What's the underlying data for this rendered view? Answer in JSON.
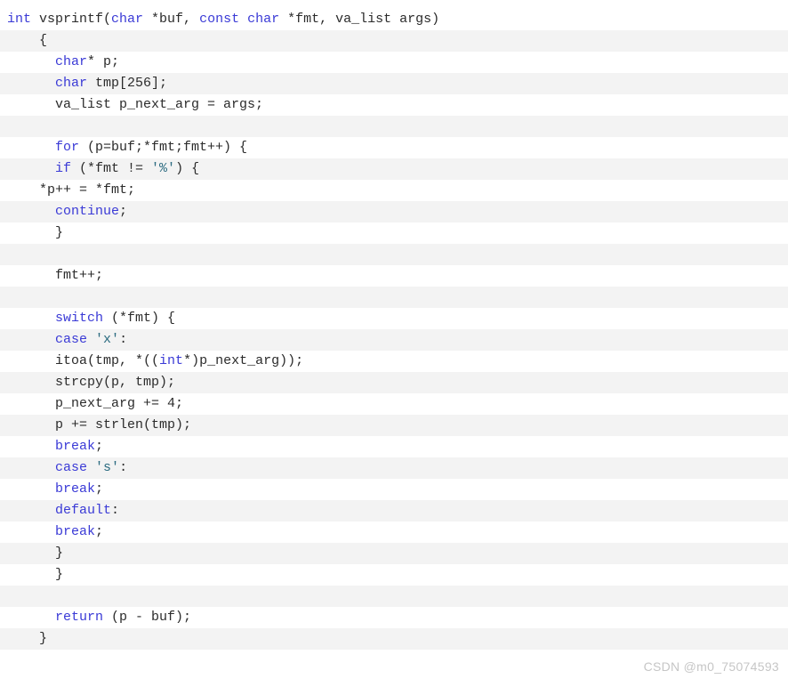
{
  "code_block": {
    "language": "c",
    "background": "#ffffff",
    "stripe_background": "#f3f3f3",
    "keyword_color": "#3a3ad6",
    "string_color": "#2b6b80",
    "text_color": "#2b2b2b",
    "lines": [
      {
        "indent": 0,
        "tokens": [
          {
            "t": "int",
            "c": "kw"
          },
          {
            "t": " vsprintf(",
            "c": "plain"
          },
          {
            "t": "char",
            "c": "kw"
          },
          {
            "t": " *buf, ",
            "c": "plain"
          },
          {
            "t": "const",
            "c": "kw"
          },
          {
            "t": " ",
            "c": "plain"
          },
          {
            "t": "char",
            "c": "kw"
          },
          {
            "t": " *fmt, va_list args)",
            "c": "plain"
          }
        ]
      },
      {
        "indent": 2,
        "tokens": [
          {
            "t": "{",
            "c": "plain"
          }
        ]
      },
      {
        "indent": 3,
        "tokens": [
          {
            "t": "char",
            "c": "kw"
          },
          {
            "t": "* p;",
            "c": "plain"
          }
        ]
      },
      {
        "indent": 3,
        "tokens": [
          {
            "t": "char",
            "c": "kw"
          },
          {
            "t": " tmp[256];",
            "c": "plain"
          }
        ]
      },
      {
        "indent": 3,
        "tokens": [
          {
            "t": "va_list p_next_arg = args;",
            "c": "plain"
          }
        ]
      },
      {
        "indent": 0,
        "tokens": []
      },
      {
        "indent": 3,
        "tokens": [
          {
            "t": "for",
            "c": "kw"
          },
          {
            "t": " (p=buf;*fmt;fmt++) {",
            "c": "plain"
          }
        ]
      },
      {
        "indent": 3,
        "tokens": [
          {
            "t": "if",
            "c": "kw"
          },
          {
            "t": " (*fmt != ",
            "c": "plain"
          },
          {
            "t": "'%'",
            "c": "str"
          },
          {
            "t": ") {",
            "c": "plain"
          }
        ]
      },
      {
        "indent": 2,
        "tokens": [
          {
            "t": "*p++ = *fmt;",
            "c": "plain"
          }
        ]
      },
      {
        "indent": 3,
        "tokens": [
          {
            "t": "continue",
            "c": "kw"
          },
          {
            "t": ";",
            "c": "plain"
          }
        ]
      },
      {
        "indent": 3,
        "tokens": [
          {
            "t": "}",
            "c": "plain"
          }
        ]
      },
      {
        "indent": 0,
        "tokens": []
      },
      {
        "indent": 3,
        "tokens": [
          {
            "t": "fmt++;",
            "c": "plain"
          }
        ]
      },
      {
        "indent": 0,
        "tokens": []
      },
      {
        "indent": 3,
        "tokens": [
          {
            "t": "switch",
            "c": "kw"
          },
          {
            "t": " (*fmt) {",
            "c": "plain"
          }
        ]
      },
      {
        "indent": 3,
        "tokens": [
          {
            "t": "case",
            "c": "kw"
          },
          {
            "t": " ",
            "c": "plain"
          },
          {
            "t": "'x'",
            "c": "str"
          },
          {
            "t": ":",
            "c": "plain"
          }
        ]
      },
      {
        "indent": 3,
        "tokens": [
          {
            "t": "itoa(tmp, *((",
            "c": "plain"
          },
          {
            "t": "int",
            "c": "kw"
          },
          {
            "t": "*)p_next_arg));",
            "c": "plain"
          }
        ]
      },
      {
        "indent": 3,
        "tokens": [
          {
            "t": "strcpy(p, tmp);",
            "c": "plain"
          }
        ]
      },
      {
        "indent": 3,
        "tokens": [
          {
            "t": "p_next_arg += 4;",
            "c": "plain"
          }
        ]
      },
      {
        "indent": 3,
        "tokens": [
          {
            "t": "p += strlen(tmp);",
            "c": "plain"
          }
        ]
      },
      {
        "indent": 3,
        "tokens": [
          {
            "t": "break",
            "c": "kw"
          },
          {
            "t": ";",
            "c": "plain"
          }
        ]
      },
      {
        "indent": 3,
        "tokens": [
          {
            "t": "case",
            "c": "kw"
          },
          {
            "t": " ",
            "c": "plain"
          },
          {
            "t": "'s'",
            "c": "str"
          },
          {
            "t": ":",
            "c": "plain"
          }
        ]
      },
      {
        "indent": 3,
        "tokens": [
          {
            "t": "break",
            "c": "kw"
          },
          {
            "t": ";",
            "c": "plain"
          }
        ]
      },
      {
        "indent": 3,
        "tokens": [
          {
            "t": "default",
            "c": "kw"
          },
          {
            "t": ":",
            "c": "plain"
          }
        ]
      },
      {
        "indent": 3,
        "tokens": [
          {
            "t": "break",
            "c": "kw"
          },
          {
            "t": ";",
            "c": "plain"
          }
        ]
      },
      {
        "indent": 3,
        "tokens": [
          {
            "t": "}",
            "c": "plain"
          }
        ]
      },
      {
        "indent": 3,
        "tokens": [
          {
            "t": "}",
            "c": "plain"
          }
        ]
      },
      {
        "indent": 0,
        "tokens": []
      },
      {
        "indent": 3,
        "tokens": [
          {
            "t": "return",
            "c": "kw"
          },
          {
            "t": " (p - buf);",
            "c": "plain"
          }
        ]
      },
      {
        "indent": 2,
        "tokens": [
          {
            "t": "}",
            "c": "plain"
          }
        ]
      },
      {
        "indent": 0,
        "tokens": []
      }
    ]
  },
  "watermark": {
    "text": "CSDN @m0_75074593"
  }
}
